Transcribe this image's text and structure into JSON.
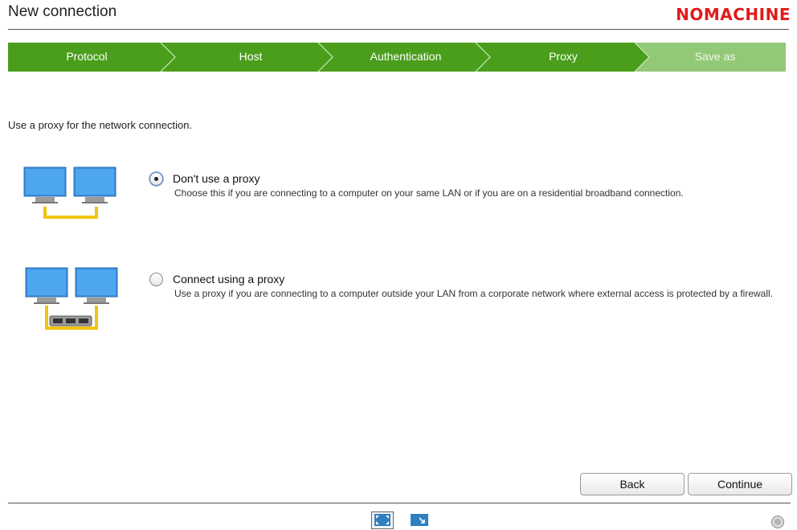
{
  "header": {
    "title": "New connection",
    "brand": "NOMACHINE",
    "brand_color": "#e01b1b"
  },
  "steps": [
    {
      "label": "Protocol",
      "active": true
    },
    {
      "label": "Host",
      "active": true
    },
    {
      "label": "Authentication",
      "active": true
    },
    {
      "label": "Proxy",
      "active": true,
      "current": true
    },
    {
      "label": "Save as",
      "active": false
    }
  ],
  "step_colors": {
    "active": "#4a9e1c",
    "inactive": "#92c977"
  },
  "intro": "Use a proxy for the network connection.",
  "options": [
    {
      "title": "Don't use a proxy",
      "description": "Choose this if you are connecting to a computer on your same LAN or if you are on a residential broadband connection.",
      "selected": true,
      "icon": "direct-lan-icon"
    },
    {
      "title": "Connect using a proxy",
      "description": "Use a proxy if you are connecting to a computer outside your LAN from a corporate network where external access is protected by a firewall.",
      "selected": false,
      "icon": "proxy-firewall-icon"
    }
  ],
  "buttons": {
    "back": "Back",
    "continue": "Continue"
  },
  "footer_icons": [
    "fullscreen-view-icon",
    "window-view-icon",
    "info-icon"
  ]
}
